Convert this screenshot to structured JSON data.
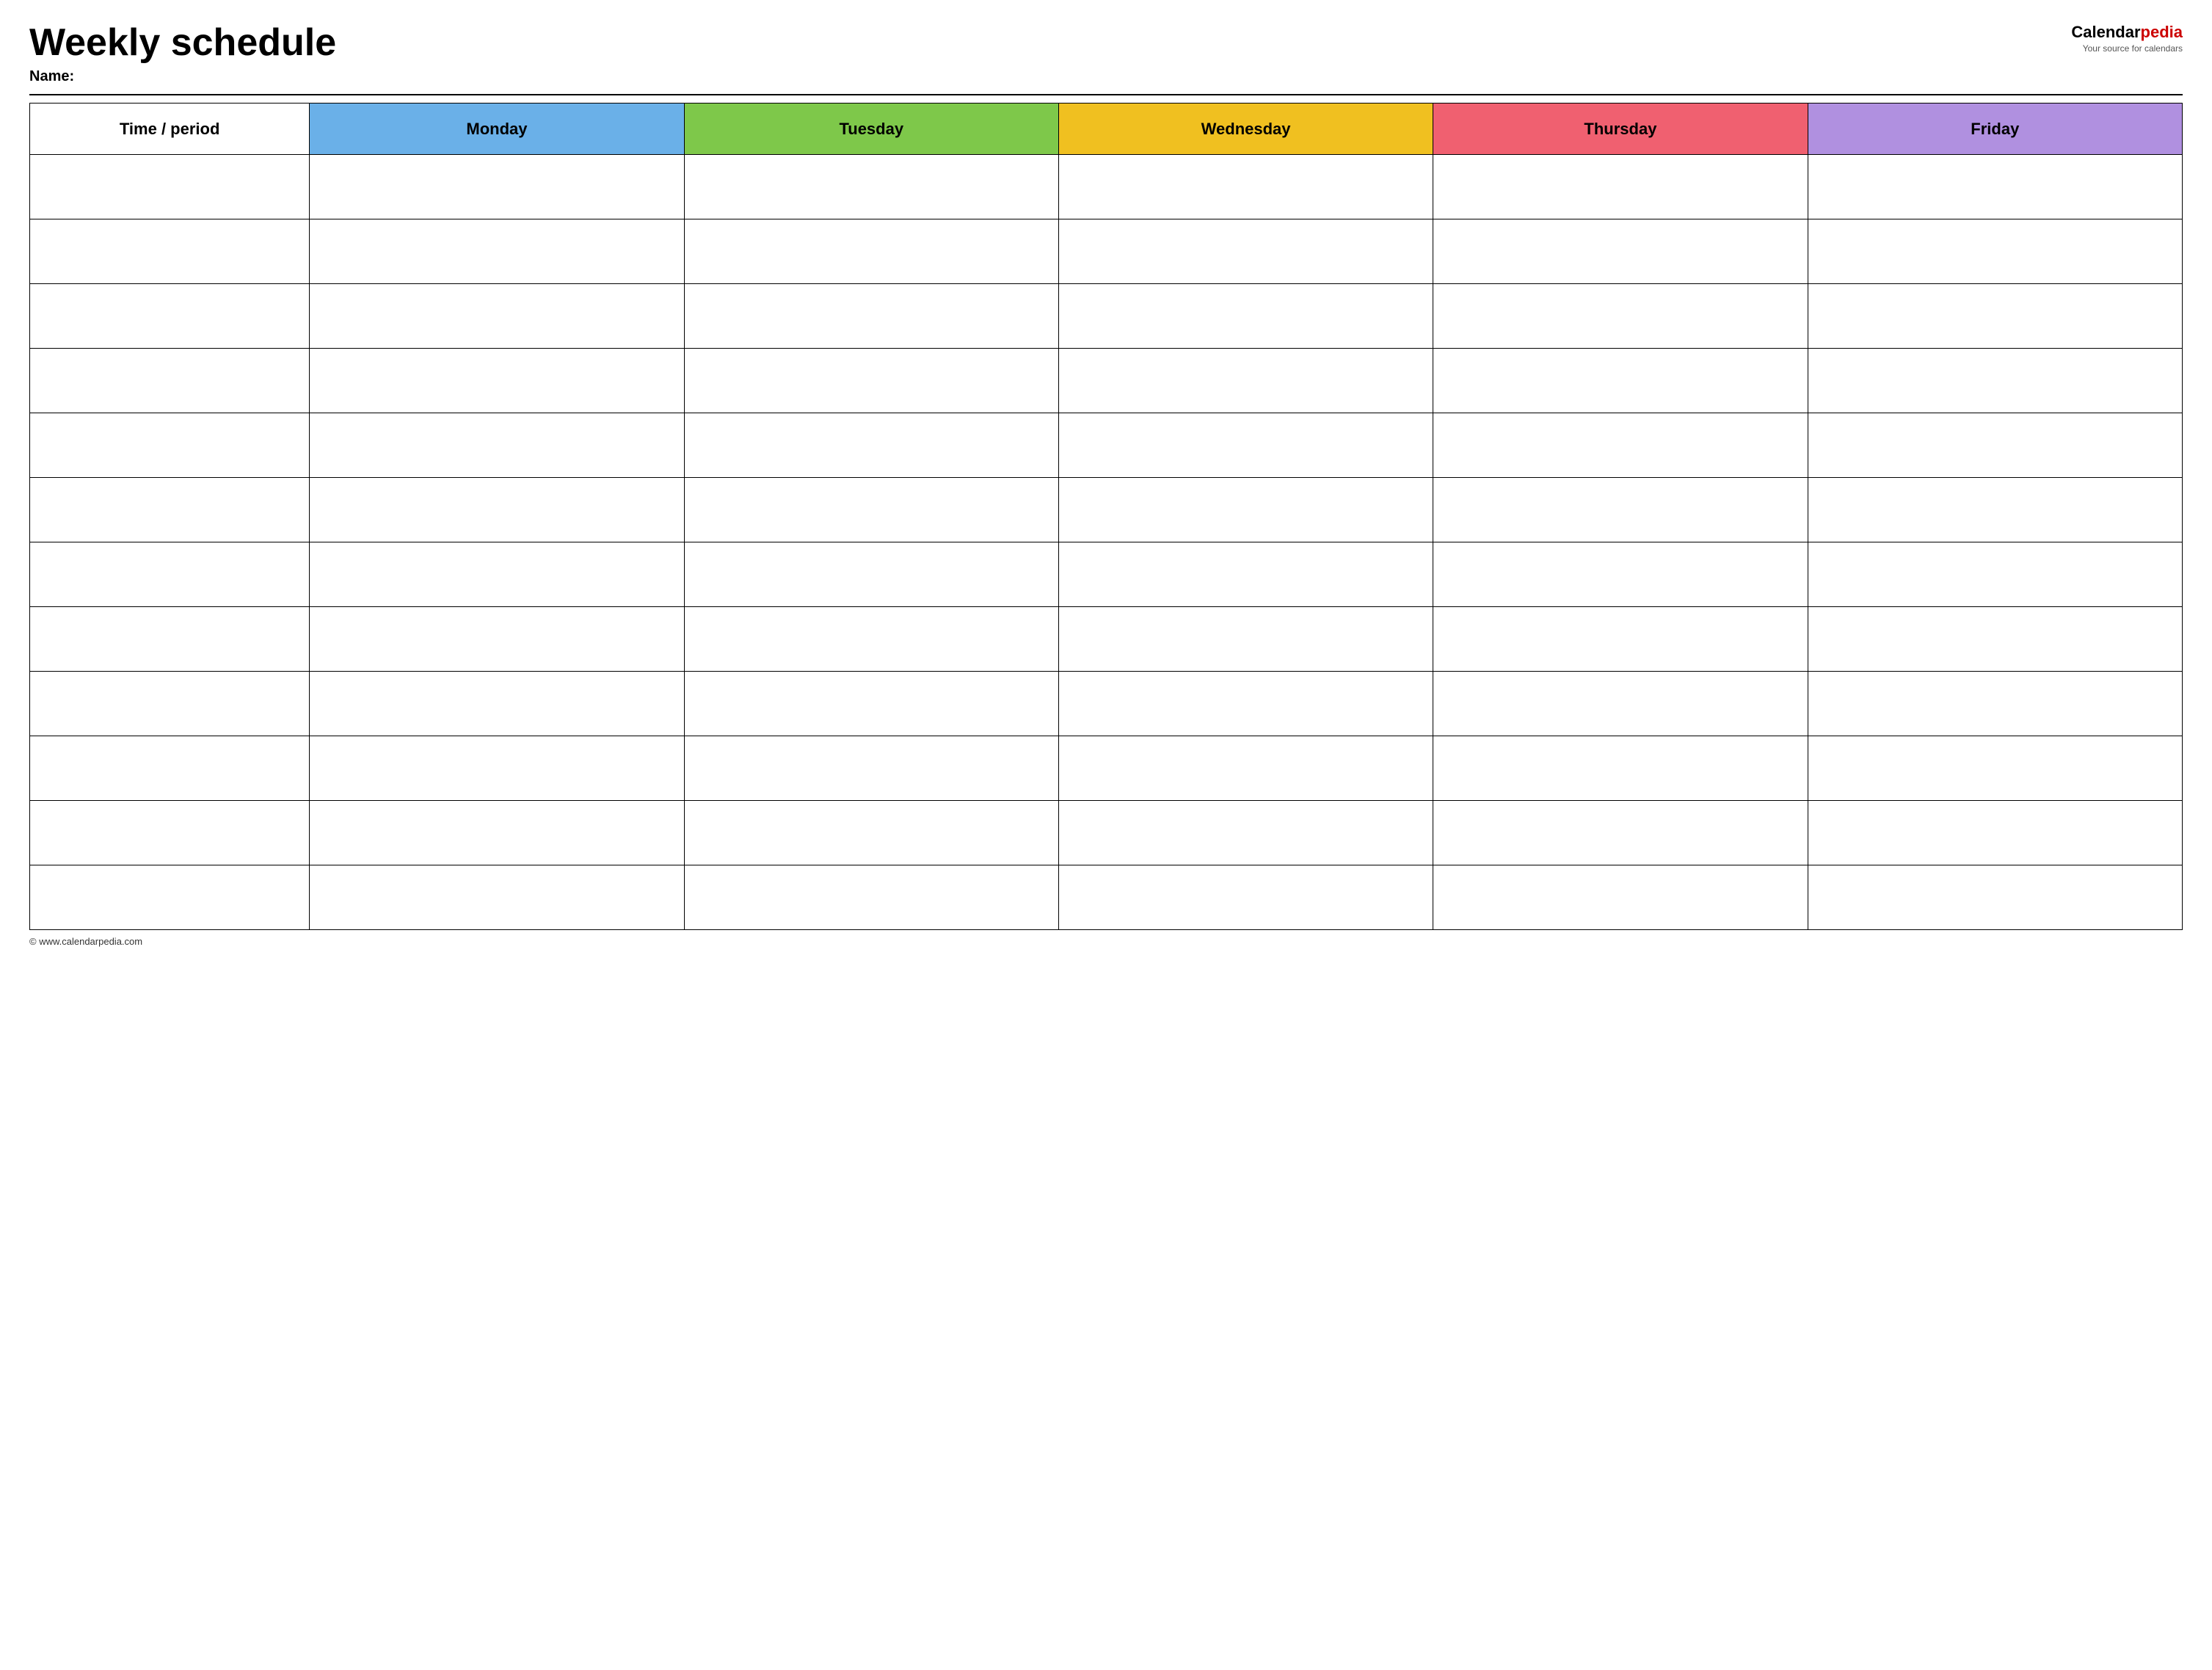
{
  "header": {
    "title": "Weekly schedule",
    "name_label": "Name:",
    "logo_calendar": "Calendar",
    "logo_pedia": "pedia",
    "logo_subtitle": "Your source for calendars"
  },
  "table": {
    "columns": [
      {
        "id": "time",
        "label": "Time / period",
        "color": "#ffffff"
      },
      {
        "id": "monday",
        "label": "Monday",
        "color": "#6ab0e8"
      },
      {
        "id": "tuesday",
        "label": "Tuesday",
        "color": "#7ec84a"
      },
      {
        "id": "wednesday",
        "label": "Wednesday",
        "color": "#f0c020"
      },
      {
        "id": "thursday",
        "label": "Thursday",
        "color": "#f06070"
      },
      {
        "id": "friday",
        "label": "Friday",
        "color": "#b090e0"
      }
    ],
    "row_count": 12
  },
  "footer": {
    "copyright": "© www.calendarpedia.com"
  }
}
